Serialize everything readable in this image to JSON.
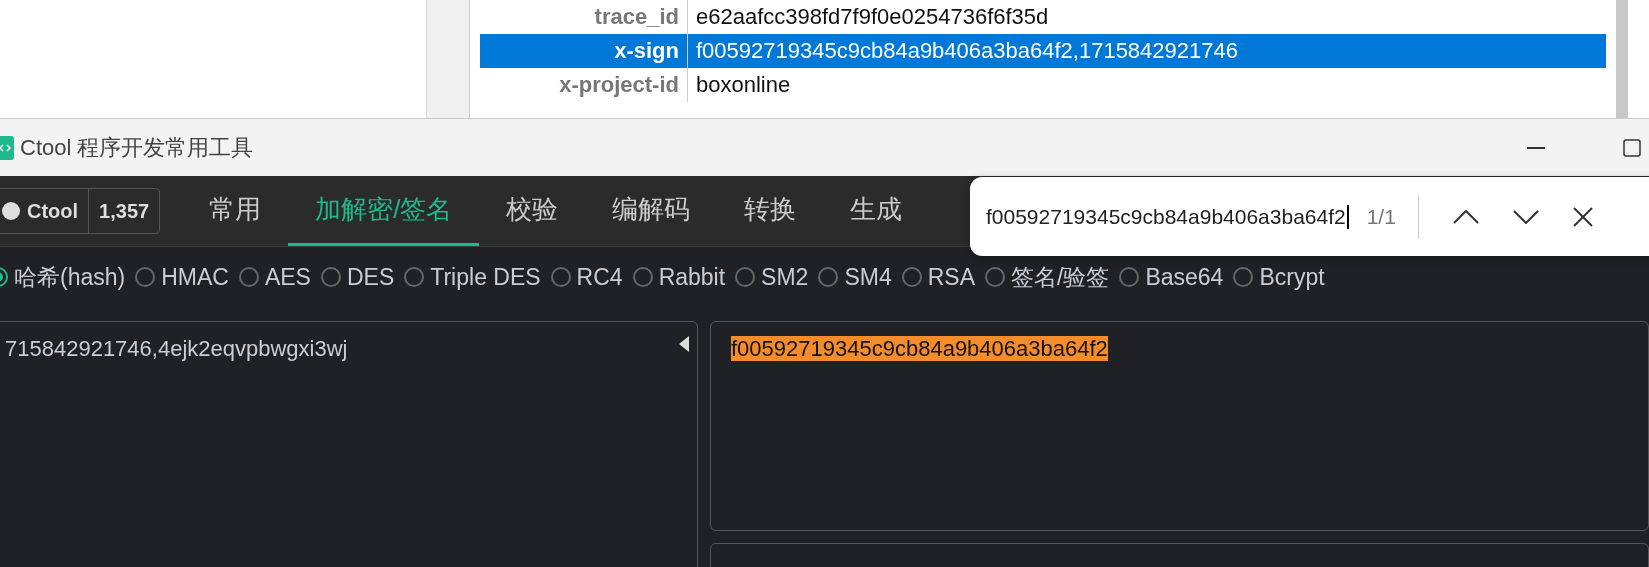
{
  "background_window": {
    "rows": [
      {
        "key": "trace_id",
        "value": "e62aafcc398fd7f9f0e0254736f6f35d",
        "selected": false
      },
      {
        "key": "x-sign",
        "value": "f00592719345c9cb84a9b406a3ba64f2,1715842921746",
        "selected": true
      },
      {
        "key": "x-project-id",
        "value": "boxonline",
        "selected": false
      }
    ]
  },
  "window": {
    "title": "Ctool 程序开发常用工具"
  },
  "github": {
    "label": "Ctool",
    "count": "1,357"
  },
  "tabs": [
    {
      "label": "常用",
      "selected": false
    },
    {
      "label": "加解密/签名",
      "selected": true
    },
    {
      "label": "校验",
      "selected": false
    },
    {
      "label": "编解码",
      "selected": false
    },
    {
      "label": "转换",
      "selected": false
    },
    {
      "label": "生成",
      "selected": false
    }
  ],
  "find_bar": {
    "value": "f00592719345c9cb84a9b406a3ba64f2",
    "count": "1/1"
  },
  "algorithms": [
    {
      "label": "哈希(hash)",
      "selected": true
    },
    {
      "label": "HMAC",
      "selected": false
    },
    {
      "label": "AES",
      "selected": false
    },
    {
      "label": "DES",
      "selected": false
    },
    {
      "label": "Triple DES",
      "selected": false
    },
    {
      "label": "RC4",
      "selected": false
    },
    {
      "label": "Rabbit",
      "selected": false
    },
    {
      "label": "SM2",
      "selected": false
    },
    {
      "label": "SM4",
      "selected": false
    },
    {
      "label": "RSA",
      "selected": false
    },
    {
      "label": "签名/验签",
      "selected": false
    },
    {
      "label": "Base64",
      "selected": false
    },
    {
      "label": "Bcrypt",
      "selected": false
    }
  ],
  "input": {
    "value": "715842921746,4ejk2eqvpbwgxi3wj"
  },
  "output": {
    "value": "f00592719345c9cb84a9b406a3ba64f2",
    "highlighted": true
  }
}
